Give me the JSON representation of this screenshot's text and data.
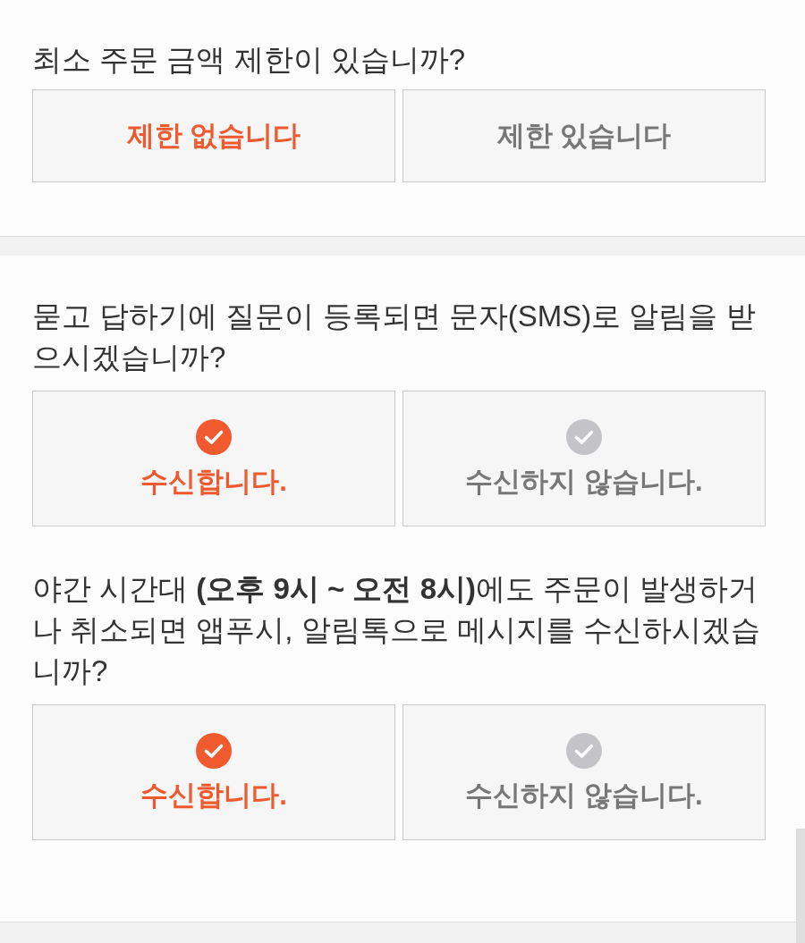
{
  "sections": [
    {
      "questions": [
        {
          "kind": "plain",
          "text": "최소 주문 금액 제한이 있습니까?",
          "options": [
            {
              "label": "제한 없습니다",
              "selected": true
            },
            {
              "label": "제한 있습니다",
              "selected": false
            }
          ]
        }
      ]
    },
    {
      "questions": [
        {
          "kind": "check",
          "text": "묻고 답하기에 질문이 등록되면 문자(SMS)로 알림을 받으시겠습니까?",
          "options": [
            {
              "label": "수신합니다.",
              "selected": true
            },
            {
              "label": "수신하지 않습니다.",
              "selected": false
            }
          ]
        },
        {
          "kind": "check",
          "text": "야간 시간대 **(오후 9시 ~ 오전 8시)**에도 주문이 발생하거나 취소되면 앱푸시, 알림톡으로 메시지를 수신하시겠습니까?",
          "options": [
            {
              "label": "수신합니다.",
              "selected": true
            },
            {
              "label": "수신하지 않습니다.",
              "selected": false
            }
          ]
        }
      ]
    }
  ]
}
